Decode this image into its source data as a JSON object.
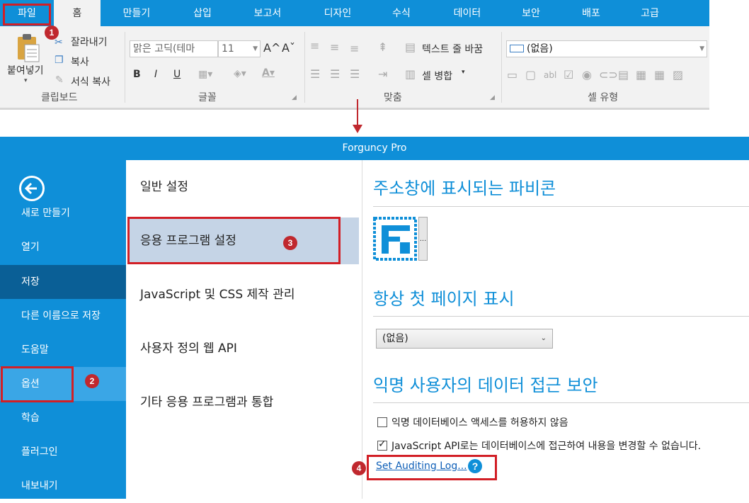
{
  "ribbon": {
    "tabs": [
      {
        "label": "파일"
      },
      {
        "label": "홈"
      },
      {
        "label": "만들기"
      },
      {
        "label": "삽입"
      },
      {
        "label": "보고서"
      },
      {
        "label": "디자인"
      },
      {
        "label": "수식"
      },
      {
        "label": "데이터"
      },
      {
        "label": "보안"
      },
      {
        "label": "배포"
      },
      {
        "label": "고급"
      }
    ],
    "clipboard": {
      "paste": "붙여넣기",
      "cut": "잘라내기",
      "copy": "복사",
      "format_painter": "서식 복사",
      "group_label": "클립보드"
    },
    "font": {
      "font_name": "맑은 고딕(테마",
      "font_size": "11",
      "grow_icon": "A^",
      "shrink_icon": "Aˇ",
      "bold": "B",
      "italic": "I",
      "underline": "U",
      "group_label": "글꼴"
    },
    "alignment": {
      "wrap_text": "텍스트 줄 바꿈",
      "merge": "셀 병합",
      "group_label": "맞춤"
    },
    "cell_type": {
      "value": "(없음)",
      "group_label": "셀 유형"
    }
  },
  "annotations": [
    "1",
    "2",
    "3",
    "4"
  ],
  "window": {
    "title": "Forguncy Pro"
  },
  "sidebar": {
    "items": [
      {
        "label": "새로 만들기"
      },
      {
        "label": "열기"
      },
      {
        "label": "저장"
      },
      {
        "label": "다른 이름으로 저장"
      },
      {
        "label": "도움말"
      },
      {
        "label": "옵션"
      },
      {
        "label": "학습"
      },
      {
        "label": "플러그인"
      },
      {
        "label": "내보내기"
      }
    ]
  },
  "options_menu": {
    "items": [
      {
        "label": "일반 설정"
      },
      {
        "label": "응용 프로그램 설정"
      },
      {
        "label": "JavaScript 및 CSS 제작 관리"
      },
      {
        "label": "사용자 정의 웹 API"
      },
      {
        "label": "기타 응용 프로그램과 통합"
      }
    ]
  },
  "settings": {
    "favicon_title": "주소창에 표시되는 파비콘",
    "browse_label": "...",
    "first_page_title": "항상 첫 페이지 표시",
    "first_page_value": "(없음)",
    "anon_title": "익명 사용자의 데이터 접근 보안",
    "chk1_label": "익명 데이터베이스 액세스를 허용하지 않음",
    "chk1_checked": false,
    "chk2_label": "JavaScript API로는 데이터베이스에 접근하여 내용을 변경할 수 없습니다.",
    "chk2_checked": true,
    "audit_link": "Set Auditing Log...",
    "help_icon": "?"
  },
  "colors": {
    "accent": "#0f8fd8",
    "annotation": "#d21f26",
    "selected": "#c5d4e6",
    "sidebar_active": "#0a5f96"
  }
}
